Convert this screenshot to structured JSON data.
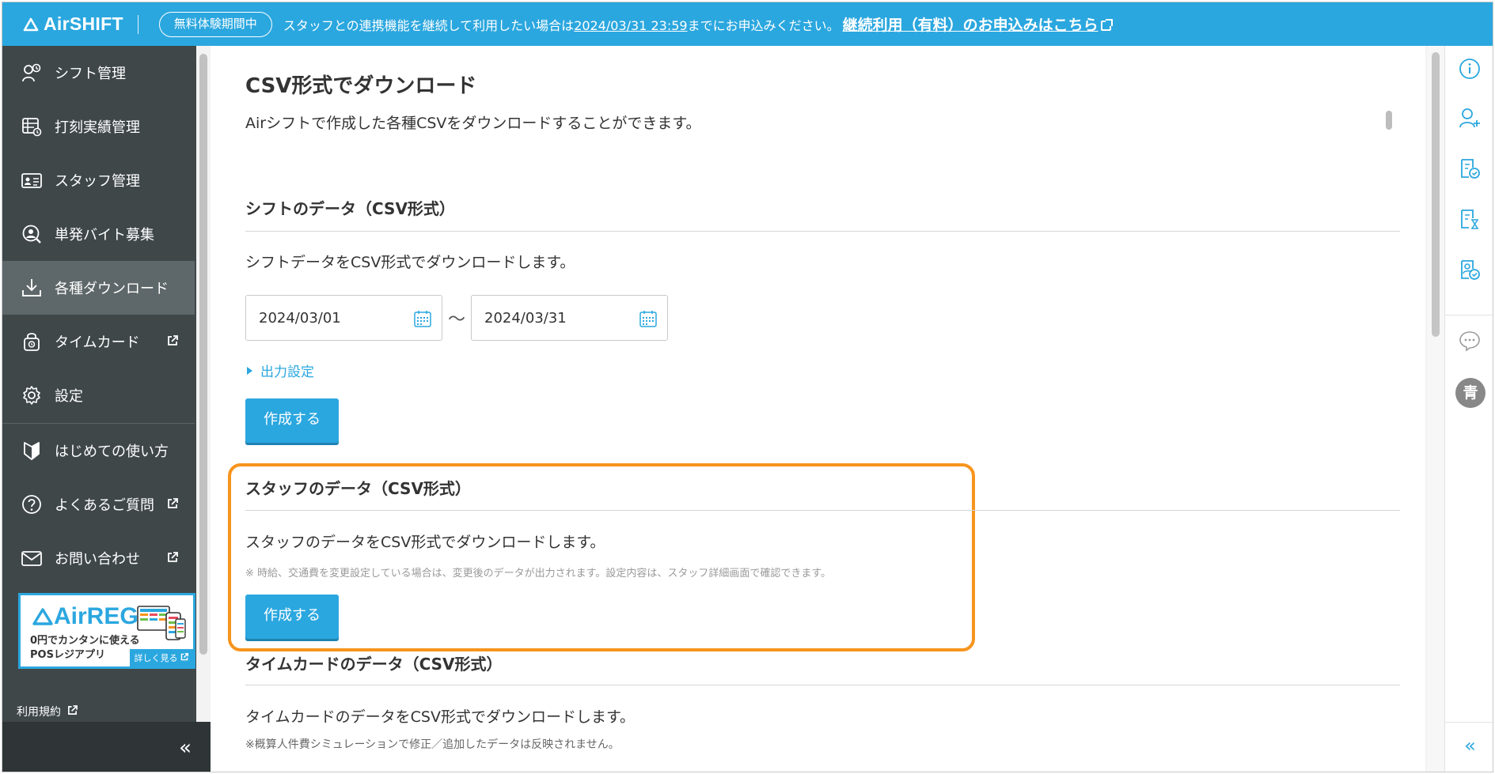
{
  "topbar": {
    "logo": "AirSHIFT",
    "trial_badge": "無料体験期間中",
    "message_before": "スタッフとの連携機能を継続して利用したい場合は",
    "message_date": "2024/03/31 23:59",
    "message_after": "までにお申込みください。",
    "link_label": "継続利用（有料）のお申込みはこちら"
  },
  "sidebar": {
    "items": [
      {
        "label": "シフト管理",
        "icon": "shift-icon"
      },
      {
        "label": "打刻実績管理",
        "icon": "timecard-table-icon"
      },
      {
        "label": "スタッフ管理",
        "icon": "staff-card-icon"
      },
      {
        "label": "単発バイト募集",
        "icon": "recruit-icon"
      },
      {
        "label": "各種ダウンロード",
        "icon": "download-icon",
        "active": true
      },
      {
        "label": "タイムカード",
        "icon": "lock-timecard-icon",
        "external": true
      },
      {
        "label": "設定",
        "icon": "gear-icon"
      },
      {
        "label": "はじめての使い方",
        "icon": "beginner-mark-icon"
      },
      {
        "label": "よくあるご質問",
        "icon": "question-icon",
        "external": true
      },
      {
        "label": "お問い合わせ",
        "icon": "mail-icon",
        "external": true
      }
    ],
    "ad": {
      "logo": "AirREGI",
      "line1": "0円でカンタンに使える",
      "line2": "POSレジアプリ",
      "more": "詳しく見る"
    },
    "terms": "利用規約",
    "collapse": "«"
  },
  "main": {
    "title": "CSV形式でダウンロード",
    "description": "Airシフトで作成した各種CSVをダウンロードすることができます。",
    "shift_section": {
      "title": "シフトのデータ（CSV形式）",
      "description": "シフトデータをCSV形式でダウンロードします。",
      "date_from": "2024/03/01",
      "date_to": "2024/03/31",
      "range_separator": "〜",
      "output_settings": "出力設定",
      "button": "作成する"
    },
    "staff_section": {
      "title": "スタッフのデータ（CSV形式）",
      "description": "スタッフのデータをCSV形式でダウンロードします。",
      "note": "※ 時給、交通費を変更設定している場合は、変更後のデータが出力されます。設定内容は、スタッフ詳細画面で確認できます。",
      "button": "作成する"
    },
    "timecard_section": {
      "title": "タイムカードのデータ（CSV形式）",
      "description": "タイムカードのデータをCSV形式でダウンロードします。",
      "note": "※概算人件費シミュレーションで修正／追加したデータは反映されません。"
    }
  },
  "right_rail": {
    "avatar": "青",
    "collapse": "«"
  },
  "colors": {
    "brand": "#2ba7df",
    "sidebar_bg": "#3f4749",
    "sidebar_active": "#5e6769",
    "highlight": "#f7941d"
  }
}
